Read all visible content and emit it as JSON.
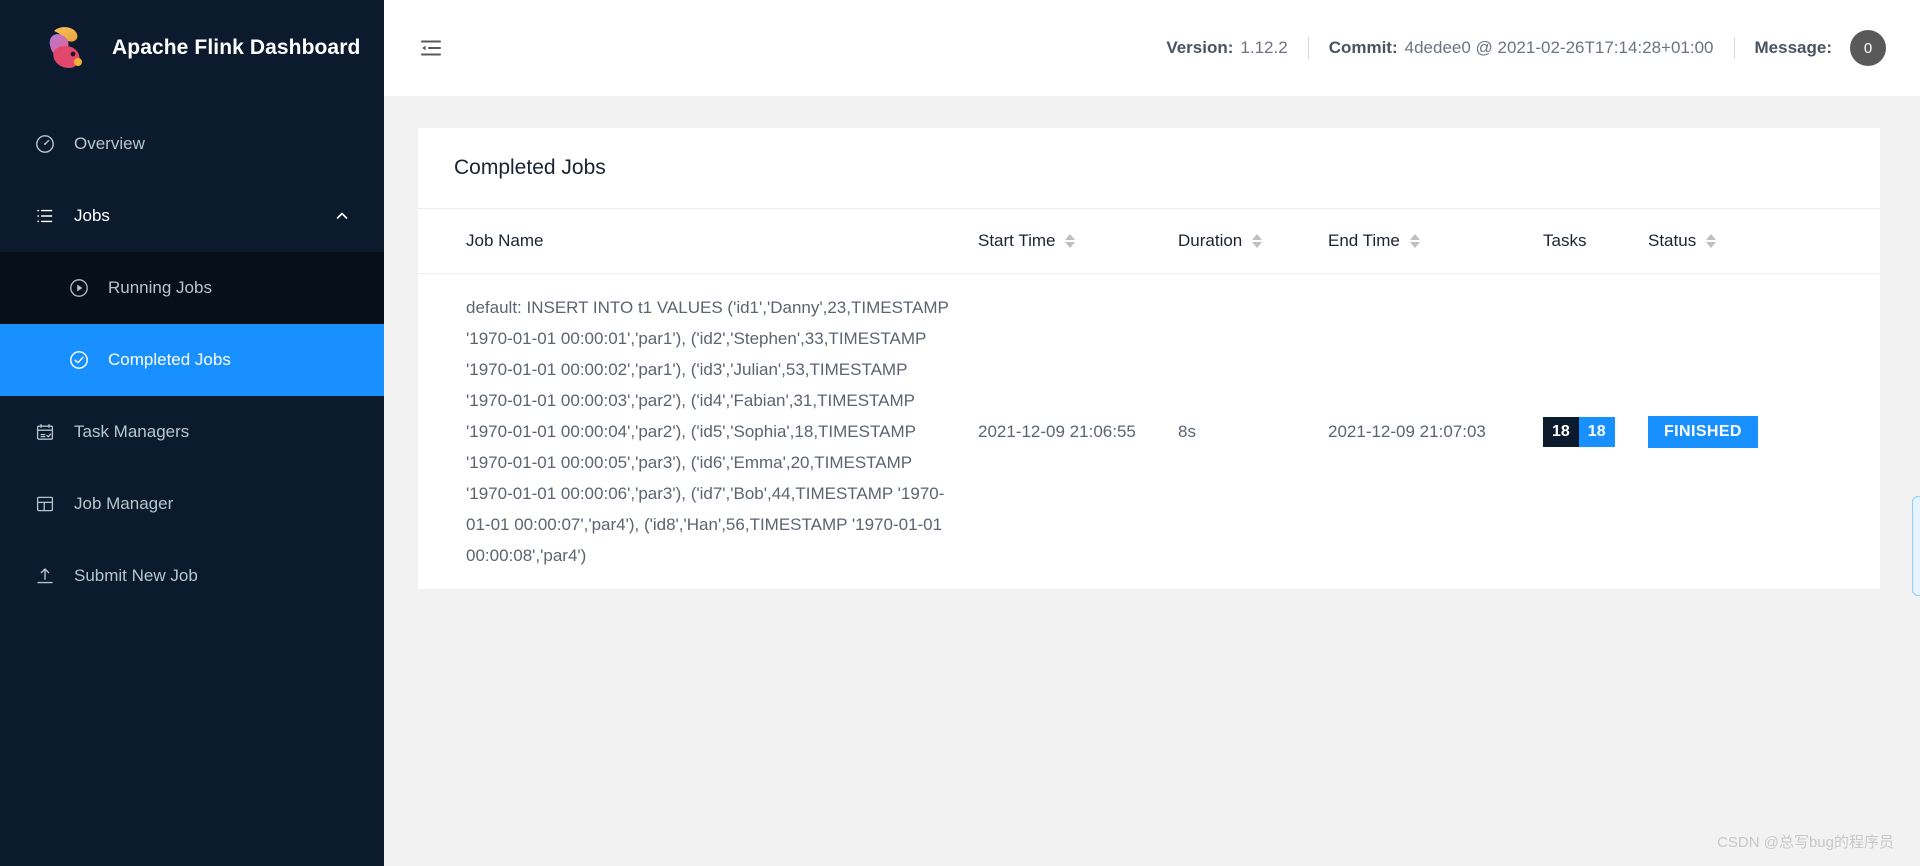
{
  "sidebar": {
    "brand": {
      "title": "Apache Flink Dashboard",
      "logo_icon": "flink-squirrel-logo"
    },
    "items": [
      {
        "label": "Overview",
        "icon": "dashboard-icon"
      },
      {
        "label": "Jobs",
        "icon": "list-icon",
        "expanded": true
      },
      {
        "label": "Running Jobs",
        "icon": "play-circle-icon",
        "sub": true
      },
      {
        "label": "Completed Jobs",
        "icon": "check-circle-icon",
        "sub": true,
        "active": true
      },
      {
        "label": "Task Managers",
        "icon": "calendar-check-icon"
      },
      {
        "label": "Job Manager",
        "icon": "layout-icon"
      },
      {
        "label": "Submit New Job",
        "icon": "upload-icon"
      }
    ]
  },
  "topbar": {
    "fold_icon": "menu-fold-icon",
    "version_label": "Version:",
    "version_value": "1.12.2",
    "commit_label": "Commit:",
    "commit_value": "4dedee0 @ 2021-02-26T17:14:28+01:00",
    "message_label": "Message:",
    "message_count": "0"
  },
  "card": {
    "title": "Completed Jobs",
    "columns": [
      {
        "key": "job_name",
        "label": "Job Name",
        "sortable": false
      },
      {
        "key": "start_time",
        "label": "Start Time",
        "sortable": true
      },
      {
        "key": "duration",
        "label": "Duration",
        "sortable": true
      },
      {
        "key": "end_time",
        "label": "End Time",
        "sortable": true
      },
      {
        "key": "tasks",
        "label": "Tasks",
        "sortable": false
      },
      {
        "key": "status",
        "label": "Status",
        "sortable": true
      }
    ],
    "rows": [
      {
        "job_name": "default: INSERT INTO t1 VALUES ('id1','Danny',23,TIMESTAMP '1970-01-01 00:00:01','par1'), ('id2','Stephen',33,TIMESTAMP '1970-01-01 00:00:02','par1'), ('id3','Julian',53,TIMESTAMP '1970-01-01 00:00:03','par2'), ('id4','Fabian',31,TIMESTAMP '1970-01-01 00:00:04','par2'), ('id5','Sophia',18,TIMESTAMP '1970-01-01 00:00:05','par3'), ('id6','Emma',20,TIMESTAMP '1970-01-01 00:00:06','par3'), ('id7','Bob',44,TIMESTAMP '1970-01-01 00:00:07','par4'), ('id8','Han',56,TIMESTAMP '1970-01-01 00:00:08','par4')",
        "start_time": "2021-12-09 21:06:55",
        "duration": "8s",
        "end_time": "2021-12-09 21:07:03",
        "tasks_total": "18",
        "tasks_finished": "18",
        "status": "FINISHED"
      }
    ]
  },
  "watermark": "CSDN @总写bug的程序员",
  "colors": {
    "sidebar_bg": "#0b1b2d",
    "accent_blue": "#1890ff",
    "sub_dim_bg": "#060f1a",
    "status_finished": "#1890ff"
  }
}
